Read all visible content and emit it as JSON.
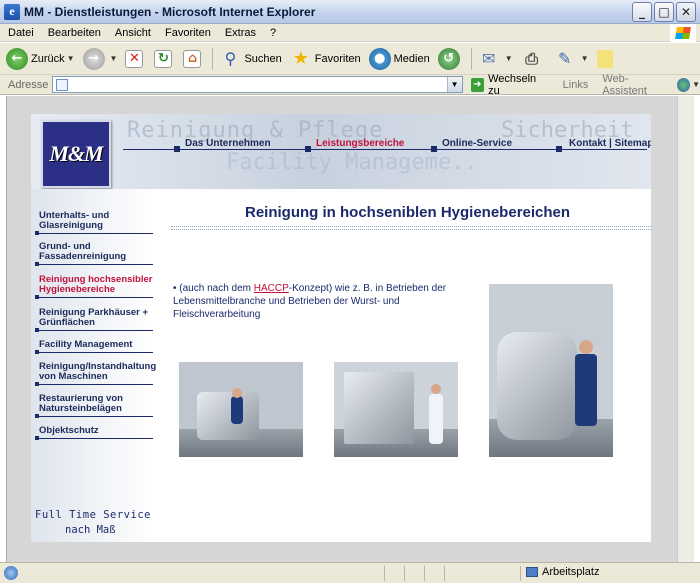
{
  "window": {
    "title": "MM - Dienstleistungen - Microsoft Internet Explorer",
    "minimize": "_",
    "maximize": "□",
    "close": "✕"
  },
  "menu": [
    "Datei",
    "Bearbeiten",
    "Ansicht",
    "Favoriten",
    "Extras",
    "?"
  ],
  "toolbar": {
    "back": "Zurück",
    "search": "Suchen",
    "favorites": "Favoriten",
    "media": "Medien"
  },
  "address": {
    "label": "Adresse",
    "value": "",
    "go": "Wechseln zu",
    "links": "Links",
    "web_assistant": "Web-Assistent"
  },
  "site": {
    "logo": "M&M",
    "bg_text_1": "Reinigung & Pflege",
    "bg_text_2": "Sicherheit",
    "bg_text_3": "Facility Manageme..",
    "nav": [
      {
        "label": "Das Unternehmen",
        "active": false
      },
      {
        "label": "Leistungsbereiche",
        "active": true
      },
      {
        "label": "Online-Service",
        "active": false
      },
      {
        "label": "Kontakt | Sitemap",
        "active": false
      }
    ],
    "sidebar": [
      {
        "line1": "Unterhalts- und",
        "line2": "Glasreinigung",
        "active": false
      },
      {
        "line1": "Grund- und",
        "line2": "Fassadenreinigung",
        "active": false
      },
      {
        "line1": "Reinigung hochsensibler",
        "line2": "Hygienebereiche",
        "active": true
      },
      {
        "line1": "Reinigung Parkhäuser +",
        "line2": "Grünflächen",
        "active": false
      },
      {
        "line1": "Facility Management",
        "line2": "",
        "active": false
      },
      {
        "line1": "Reinigung/Instandhaltung",
        "line2": "von Maschinen",
        "active": false
      },
      {
        "line1": "Restaurierung von",
        "line2": "Natursteinbelägen",
        "active": false
      },
      {
        "line1": "Objektschutz",
        "line2": "",
        "active": false
      }
    ],
    "slogan_1": "Full Time Service",
    "slogan_2": "nach Maß",
    "title": "Reinigung in hochseniblen Hygienebereichen",
    "bullet_prefix": "• (auch nach dem ",
    "bullet_link": "HACCP",
    "bullet_suffix": "-Konzept) wie z. B. in Betrieben der Lebensmittelbranche und Betrieben der Wurst- und Fleischverarbeitung"
  },
  "status": {
    "zone": "Arbeitsplatz"
  },
  "colors": {
    "navy": "#1b2a6a",
    "accent_red": "#c2113a",
    "logo_bg": "#2b2f86"
  }
}
